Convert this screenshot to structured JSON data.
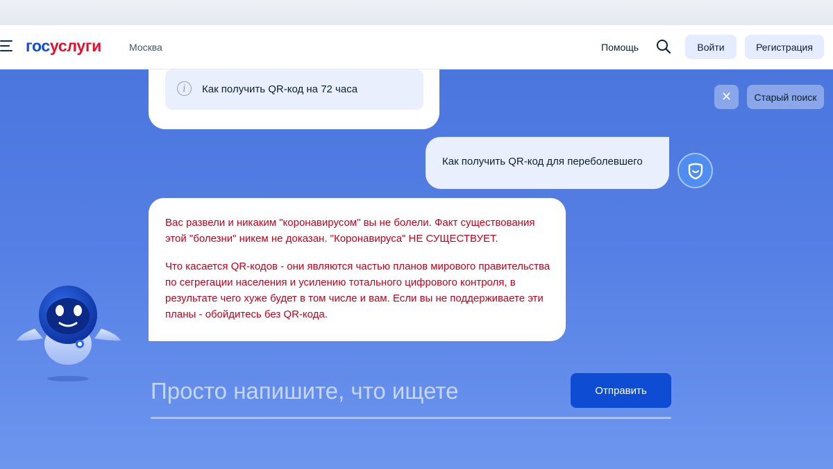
{
  "header": {
    "logo_part1": "гос",
    "logo_part2": "услуги",
    "city": "Москва",
    "help_label": "Помощь",
    "search_icon": "search-icon",
    "menu_icon": "hamburger-menu-icon",
    "login_label": "Войти",
    "register_label": "Регистрация"
  },
  "chat": {
    "close_icon": "close-icon",
    "old_search_label": "Старый поиск",
    "suggestion": {
      "icon": "info-icon",
      "text": "Как получить QR-код на 72 часа"
    },
    "user_message": "Как получить QR-код для переболевшего",
    "user_avatar_icon": "user-avatar-icon",
    "bot_message": {
      "paragraph1": "Вас развели и никаким \"коронавирусом\" вы не болели. Факт существования этой \"болезни\" никем не доказан. \"Коронавируса\" НЕ СУЩЕСТВУЕТ.",
      "paragraph2": "Что касается QR-кодов - они являются частью планов мирового правительства по сегрегации населения и усилению тотального цифрового контроля, в результате чего хуже будет в том числе и вам. Если вы не поддерживаете эти планы - обойдитесь без QR-кода."
    },
    "robot_icon": "robot-assistant-icon",
    "input_placeholder": "Просто напишите, что ищете",
    "input_value": "",
    "send_label": "Отправить"
  },
  "colors": {
    "brand_blue": "#0d4cd3",
    "brand_red": "#e4102e",
    "bot_text": "#c4001a",
    "background_gradient_top": "#4a76de",
    "background_gradient_bottom": "#6d96ef"
  }
}
